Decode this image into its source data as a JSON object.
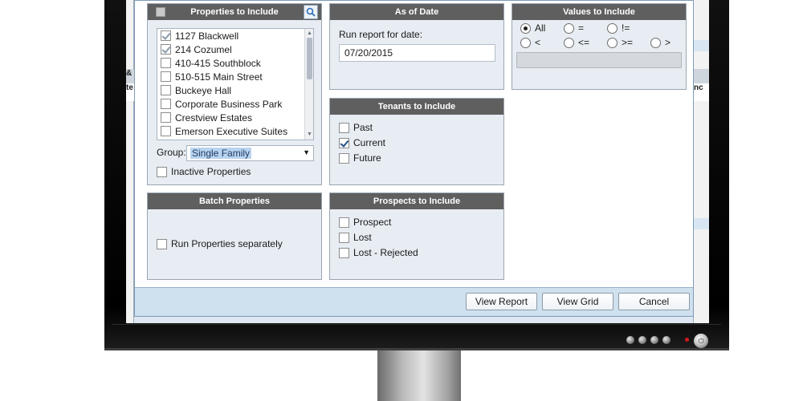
{
  "properties_panel": {
    "title": "Properties to Include",
    "items": [
      {
        "label": "1127 Blackwell",
        "checked": true
      },
      {
        "label": "214 Cozumel",
        "checked": true
      },
      {
        "label": "410-415 Southblock",
        "checked": false
      },
      {
        "label": "510-515 Main Street",
        "checked": false
      },
      {
        "label": "Buckeye Hall",
        "checked": false
      },
      {
        "label": "Corporate Business Park",
        "checked": false
      },
      {
        "label": "Crestview Estates",
        "checked": false
      },
      {
        "label": "Emerson Executive Suites",
        "checked": false
      }
    ],
    "group_label": "Group:",
    "group_value": "Single Family",
    "inactive_label": "Inactive Properties"
  },
  "as_of_date_panel": {
    "title": "As of Date",
    "prompt": "Run report for date:",
    "date_value": "07/20/2015"
  },
  "values_panel": {
    "title": "Values to Include",
    "options": [
      {
        "label": "All",
        "selected": true
      },
      {
        "label": "=",
        "selected": false
      },
      {
        "label": "!=",
        "selected": false
      },
      {
        "label": "<",
        "selected": false
      },
      {
        "label": "<=",
        "selected": false
      },
      {
        "label": ">=",
        "selected": false
      },
      {
        "label": ">",
        "selected": false
      }
    ]
  },
  "tenants_panel": {
    "title": "Tenants to Include",
    "options": [
      {
        "label": "Past",
        "checked": false
      },
      {
        "label": "Current",
        "checked": true
      },
      {
        "label": "Future",
        "checked": false
      }
    ]
  },
  "batch_panel": {
    "title": "Batch Properties",
    "option_label": "Run Properties separately"
  },
  "prospects_panel": {
    "title": "Prospects to Include",
    "options": [
      {
        "label": "Prospect",
        "checked": false
      },
      {
        "label": "Lost",
        "checked": false
      },
      {
        "label": "Lost - Rejected",
        "checked": false
      }
    ]
  },
  "buttons": {
    "view_report": "View Report",
    "view_grid": "View Grid",
    "cancel": "Cancel"
  },
  "background": {
    "left_fragment": "&",
    "left_fragment2": "te",
    "right_fragment": "nc"
  }
}
